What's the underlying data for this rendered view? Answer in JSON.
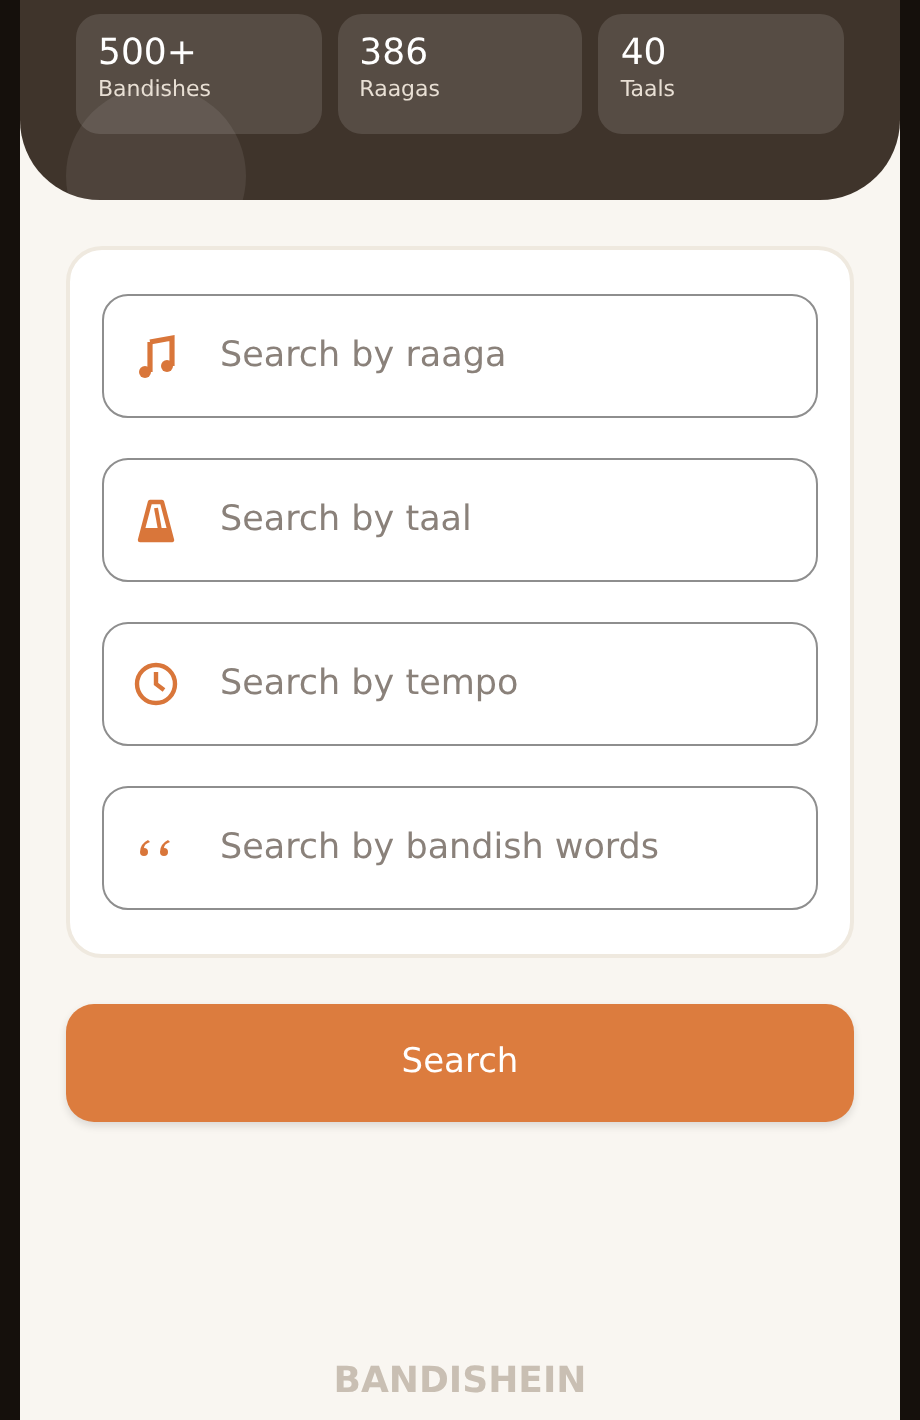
{
  "stats": [
    {
      "value": "500+",
      "label": "Bandishes"
    },
    {
      "value": "386",
      "label": "Raagas"
    },
    {
      "value": "40",
      "label": "Taals"
    }
  ],
  "search_fields": [
    {
      "kind": "note",
      "placeholder": "Search by raaga"
    },
    {
      "kind": "metronome",
      "placeholder": "Search by taal"
    },
    {
      "kind": "clock",
      "placeholder": "Search by tempo"
    },
    {
      "kind": "quote",
      "placeholder": "Search by bandish words"
    }
  ],
  "search_button": "Search",
  "footer": "BANDISHEIN"
}
